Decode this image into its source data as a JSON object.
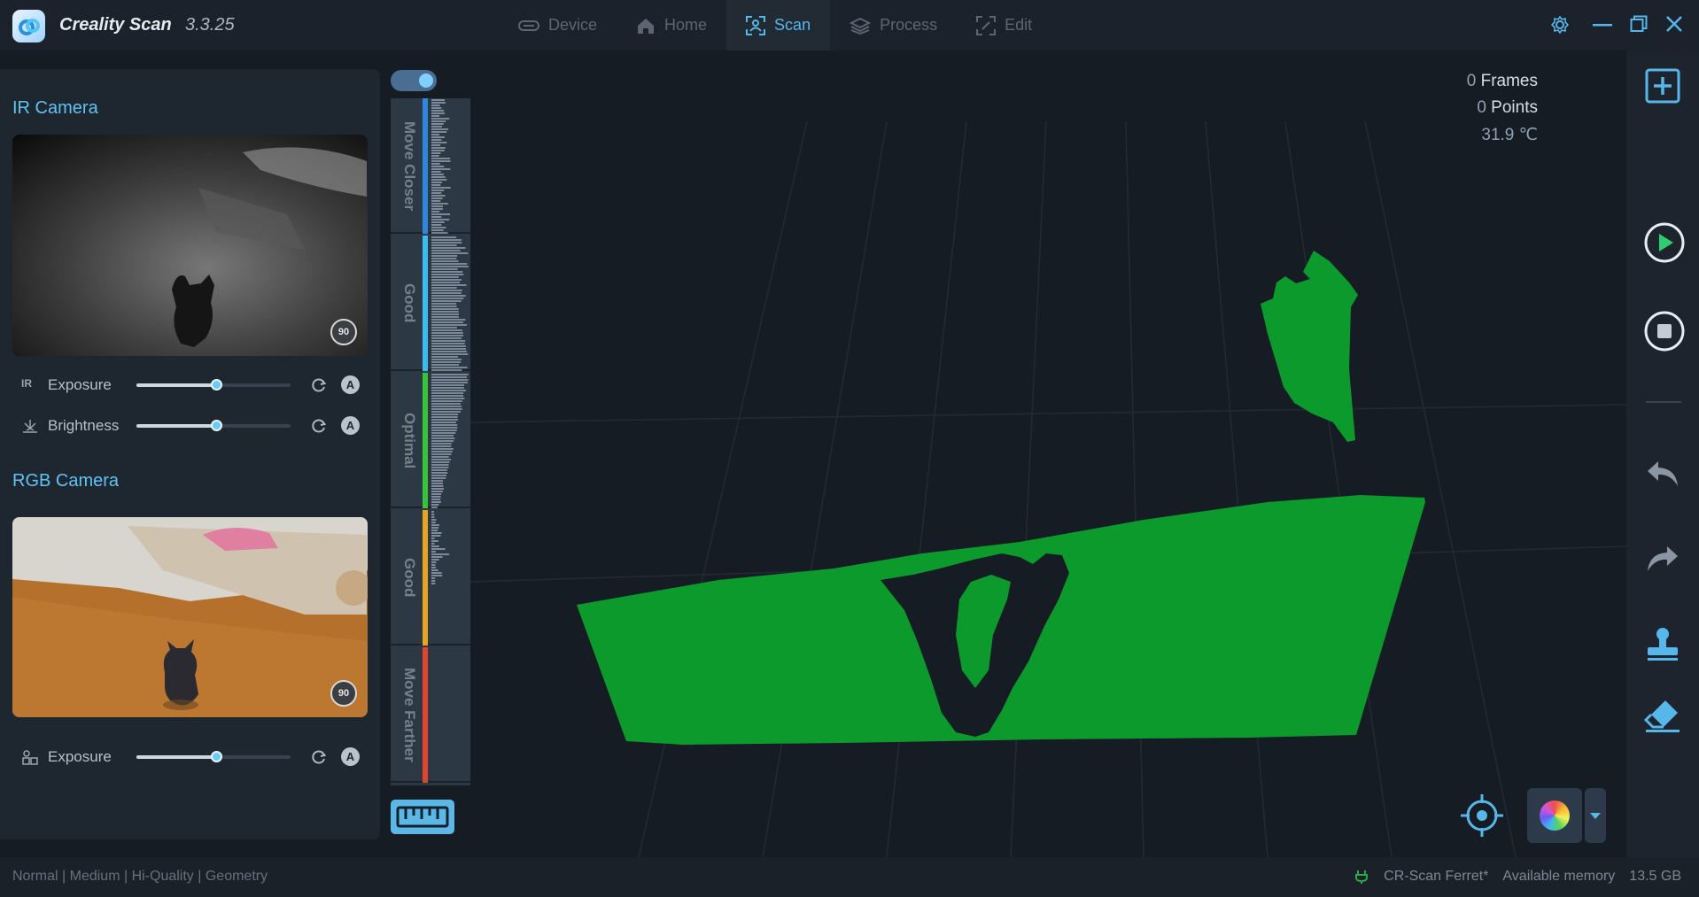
{
  "app": {
    "name": "Creality Scan",
    "version": "3.3.25"
  },
  "nav": {
    "tabs": [
      {
        "label": "Device",
        "icon": "device-icon",
        "active": false
      },
      {
        "label": "Home",
        "icon": "home-icon",
        "active": false
      },
      {
        "label": "Scan",
        "icon": "scan-icon",
        "active": true
      },
      {
        "label": "Process",
        "icon": "process-icon",
        "active": false
      },
      {
        "label": "Edit",
        "icon": "edit-icon",
        "active": false
      }
    ]
  },
  "ir_camera": {
    "title": "IR Camera",
    "rotate_label": "90",
    "exposure": {
      "icon_text": "IR",
      "label": "Exposure",
      "value": 0.52
    },
    "brightness": {
      "label": "Brightness",
      "value": 0.52
    },
    "auto_label": "A"
  },
  "rgb_camera": {
    "title": "RGB Camera",
    "rotate_label": "90",
    "exposure": {
      "label": "Exposure",
      "value": 0.52
    },
    "auto_label": "A"
  },
  "distance_meter": {
    "zones": [
      {
        "label": "Move Closer",
        "color": "#2f86e0"
      },
      {
        "label": "Good",
        "color": "#3bbcf0"
      },
      {
        "label": "Optimal",
        "color": "#38c43a"
      },
      {
        "label": "Good",
        "color": "#e6a324"
      },
      {
        "label": "Move Farther",
        "color": "#e2452e"
      }
    ]
  },
  "stats": {
    "frames_value": "0",
    "frames_label": " Frames",
    "points_value": "0",
    "points_label": " Points",
    "temperature": "31.9 ℃"
  },
  "status_bar": {
    "mode": "Normal | Medium | Hi-Quality | Geometry",
    "device": "CR-Scan Ferret*",
    "memory_label": "Available memory",
    "memory_value": "13.5 GB"
  },
  "colors": {
    "accent": "#57b6ea",
    "point_cloud": "#0c9a2c",
    "play": "#2ecc71"
  }
}
